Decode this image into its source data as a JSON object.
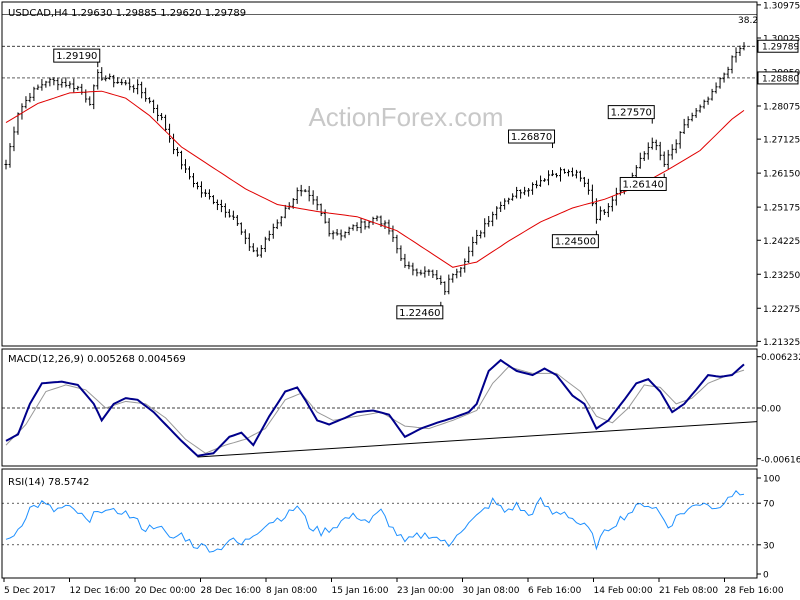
{
  "window": {
    "symbol_header": "USDCAD,H4 1.29630 1.29885 1.29620 1.29789",
    "watermark": "ActionForex.com"
  },
  "chart_data": [
    {
      "type": "line",
      "panel": "price",
      "title": "USDCAD,H4",
      "ohlc_header": {
        "open": 1.2963,
        "high": 1.29885,
        "low": 1.2962,
        "close": 1.29789
      },
      "ylim": [
        1.2125,
        1.31
      ],
      "y_ticks": [
        "1.30975",
        "1.30025",
        "1.29050",
        "1.28075",
        "1.27125",
        "1.26150",
        "1.25175",
        "1.24225",
        "1.23250",
        "1.22275",
        "1.21325"
      ],
      "x_ticks": [
        "5 Dec 2017",
        "12 Dec 16:00",
        "20 Dec 00:00",
        "28 Dec 16:00",
        "8 Jan 08:00",
        "15 Jan 16:00",
        "23 Jan 00:00",
        "30 Jan 08:00",
        "6 Feb 16:00",
        "14 Feb 00:00",
        "21 Feb 08:00",
        "28 Feb 16:00"
      ],
      "price_tags": [
        {
          "label": "1.29789",
          "value": 1.29789,
          "color": "#000000"
        },
        {
          "label": "1.28880",
          "value": 1.2888,
          "color": "#000000"
        }
      ],
      "fib_label": {
        "text": "38.2",
        "value": 1.307
      },
      "horizontal_levels": [
        1.307,
        1.29789,
        1.2888
      ],
      "annotations": [
        {
          "label": "1.29190",
          "bar": 23,
          "value": 1.2919
        },
        {
          "label": "1.22460",
          "bar": 109,
          "value": 1.2246
        },
        {
          "label": "1.26870",
          "bar": 137,
          "value": 1.2687
        },
        {
          "label": "1.24500",
          "bar": 148,
          "value": 1.245
        },
        {
          "label": "1.27570",
          "bar": 162,
          "value": 1.2757
        },
        {
          "label": "1.26140",
          "bar": 165,
          "value": 1.2614
        }
      ],
      "price_keypoints": [
        [
          0,
          1.264
        ],
        [
          3,
          1.279
        ],
        [
          6,
          1.284
        ],
        [
          10,
          1.288
        ],
        [
          14,
          1.2875
        ],
        [
          18,
          1.286
        ],
        [
          21,
          1.282
        ],
        [
          23,
          1.2895
        ],
        [
          27,
          1.288
        ],
        [
          30,
          1.287
        ],
        [
          33,
          1.286
        ],
        [
          36,
          1.282
        ],
        [
          39,
          1.277
        ],
        [
          42,
          1.269
        ],
        [
          45,
          1.262
        ],
        [
          49,
          1.256
        ],
        [
          53,
          1.253
        ],
        [
          57,
          1.249
        ],
        [
          60,
          1.242
        ],
        [
          63,
          1.238
        ],
        [
          67,
          1.246
        ],
        [
          70,
          1.251
        ],
        [
          73,
          1.256
        ],
        [
          75,
          1.2555
        ],
        [
          78,
          1.252
        ],
        [
          81,
          1.245
        ],
        [
          84,
          1.244
        ],
        [
          87,
          1.246
        ],
        [
          90,
          1.247
        ],
        [
          93,
          1.249
        ],
        [
          96,
          1.245
        ],
        [
          99,
          1.237
        ],
        [
          102,
          1.233
        ],
        [
          105,
          1.234
        ],
        [
          108,
          1.231
        ],
        [
          110,
          1.228
        ],
        [
          112,
          1.233
        ],
        [
          114,
          1.235
        ],
        [
          117,
          1.241
        ],
        [
          120,
          1.247
        ],
        [
          124,
          1.253
        ],
        [
          128,
          1.256
        ],
        [
          132,
          1.258
        ],
        [
          136,
          1.261
        ],
        [
          139,
          1.262
        ],
        [
          143,
          1.261
        ],
        [
          146,
          1.257
        ],
        [
          148,
          1.249
        ],
        [
          150,
          1.251
        ],
        [
          153,
          1.256
        ],
        [
          156,
          1.259
        ],
        [
          159,
          1.265
        ],
        [
          162,
          1.271
        ],
        [
          165,
          1.264
        ],
        [
          168,
          1.27
        ],
        [
          171,
          1.277
        ],
        [
          174,
          1.28
        ],
        [
          177,
          1.284
        ],
        [
          180,
          1.29
        ],
        [
          183,
          1.296
        ],
        [
          185,
          1.2979
        ]
      ],
      "ma_keypoints": [
        [
          0,
          1.276
        ],
        [
          8,
          1.2815
        ],
        [
          16,
          1.2845
        ],
        [
          24,
          1.285
        ],
        [
          30,
          1.283
        ],
        [
          36,
          1.278
        ],
        [
          44,
          1.269
        ],
        [
          52,
          1.263
        ],
        [
          60,
          1.257
        ],
        [
          68,
          1.2525
        ],
        [
          78,
          1.2505
        ],
        [
          88,
          1.249
        ],
        [
          98,
          1.245
        ],
        [
          106,
          1.239
        ],
        [
          112,
          1.2345
        ],
        [
          118,
          1.236
        ],
        [
          126,
          1.242
        ],
        [
          134,
          1.2475
        ],
        [
          142,
          1.2515
        ],
        [
          150,
          1.254
        ],
        [
          158,
          1.2575
        ],
        [
          166,
          1.2625
        ],
        [
          174,
          1.268
        ],
        [
          182,
          1.277
        ],
        [
          185,
          1.2795
        ]
      ]
    },
    {
      "type": "line",
      "panel": "macd",
      "title": "MACD(12,26,9) 0.005268 0.004569",
      "params": [
        12,
        26,
        9
      ],
      "values": {
        "macd": 0.005268,
        "signal": 0.004569
      },
      "ylim": [
        -0.0068,
        0.0068
      ],
      "y_ticks": [
        "0.006232",
        "0.00",
        "-0.006163"
      ],
      "zero_line": 0.0,
      "trendline": [
        [
          48,
          -0.00595
        ],
        [
          185,
          -0.00165
        ]
      ],
      "macd_keypoints": [
        [
          0,
          -0.004
        ],
        [
          3,
          -0.0032
        ],
        [
          6,
          0.0005
        ],
        [
          9,
          0.003
        ],
        [
          14,
          0.0032
        ],
        [
          18,
          0.0028
        ],
        [
          22,
          0.0005
        ],
        [
          24,
          -0.0015
        ],
        [
          27,
          0.0005
        ],
        [
          30,
          0.0012
        ],
        [
          33,
          0.001
        ],
        [
          37,
          -0.0005
        ],
        [
          40,
          -0.002
        ],
        [
          44,
          -0.004
        ],
        [
          48,
          -0.0058
        ],
        [
          52,
          -0.0055
        ],
        [
          56,
          -0.0035
        ],
        [
          59,
          -0.003
        ],
        [
          62,
          -0.0045
        ],
        [
          66,
          -0.001
        ],
        [
          70,
          0.002
        ],
        [
          73,
          0.0025
        ],
        [
          75,
          0.001
        ],
        [
          78,
          -0.0015
        ],
        [
          81,
          -0.002
        ],
        [
          85,
          -0.0012
        ],
        [
          88,
          -0.0005
        ],
        [
          92,
          -0.0003
        ],
        [
          96,
          -0.0008
        ],
        [
          100,
          -0.0035
        ],
        [
          104,
          -0.0025
        ],
        [
          108,
          -0.0018
        ],
        [
          112,
          -0.0012
        ],
        [
          116,
          -0.0005
        ],
        [
          118,
          0.0005
        ],
        [
          121,
          0.0045
        ],
        [
          124,
          0.0058
        ],
        [
          128,
          0.0045
        ],
        [
          132,
          0.004
        ],
        [
          135,
          0.0048
        ],
        [
          138,
          0.004
        ],
        [
          142,
          0.0015
        ],
        [
          145,
          0.0005
        ],
        [
          148,
          -0.0025
        ],
        [
          151,
          -0.0015
        ],
        [
          155,
          0.001
        ],
        [
          158,
          0.003
        ],
        [
          161,
          0.0035
        ],
        [
          164,
          0.002
        ],
        [
          167,
          -0.0005
        ],
        [
          170,
          0.0005
        ],
        [
          173,
          0.0022
        ],
        [
          176,
          0.004
        ],
        [
          179,
          0.0038
        ],
        [
          182,
          0.004
        ],
        [
          185,
          0.0053
        ]
      ],
      "signal_keypoints": [
        [
          0,
          -0.0045
        ],
        [
          5,
          -0.002
        ],
        [
          10,
          0.002
        ],
        [
          15,
          0.0028
        ],
        [
          20,
          0.0022
        ],
        [
          25,
          0.0
        ],
        [
          30,
          0.0008
        ],
        [
          35,
          0.0005
        ],
        [
          40,
          -0.0012
        ],
        [
          45,
          -0.0038
        ],
        [
          50,
          -0.0055
        ],
        [
          55,
          -0.0045
        ],
        [
          60,
          -0.0038
        ],
        [
          65,
          -0.0025
        ],
        [
          70,
          0.001
        ],
        [
          74,
          0.0018
        ],
        [
          78,
          -0.0005
        ],
        [
          82,
          -0.0015
        ],
        [
          88,
          -0.001
        ],
        [
          94,
          -0.0005
        ],
        [
          100,
          -0.0022
        ],
        [
          106,
          -0.0025
        ],
        [
          112,
          -0.0015
        ],
        [
          118,
          -0.0003
        ],
        [
          122,
          0.003
        ],
        [
          126,
          0.005
        ],
        [
          132,
          0.0042
        ],
        [
          138,
          0.0042
        ],
        [
          144,
          0.002
        ],
        [
          148,
          -0.001
        ],
        [
          152,
          -0.0018
        ],
        [
          156,
          0.0
        ],
        [
          160,
          0.0028
        ],
        [
          164,
          0.0025
        ],
        [
          168,
          0.0005
        ],
        [
          172,
          0.0012
        ],
        [
          176,
          0.003
        ],
        [
          180,
          0.0038
        ],
        [
          185,
          0.0046
        ]
      ]
    },
    {
      "type": "line",
      "panel": "rsi",
      "title": "RSI(14) 78.5742",
      "params": [
        14
      ],
      "values": {
        "rsi": 78.5742
      },
      "ylim": [
        0,
        100
      ],
      "y_ticks": [
        "100",
        "70",
        "30",
        "0"
      ],
      "levels": [
        70,
        30
      ],
      "rsi_keypoints": [
        [
          0,
          32
        ],
        [
          3,
          45
        ],
        [
          6,
          65
        ],
        [
          9,
          70
        ],
        [
          12,
          63
        ],
        [
          15,
          66
        ],
        [
          18,
          61
        ],
        [
          21,
          50
        ],
        [
          23,
          66
        ],
        [
          26,
          60
        ],
        [
          29,
          63
        ],
        [
          32,
          55
        ],
        [
          35,
          45
        ],
        [
          38,
          50
        ],
        [
          41,
          35
        ],
        [
          44,
          40
        ],
        [
          47,
          30
        ],
        [
          50,
          28
        ],
        [
          53,
          25
        ],
        [
          56,
          35
        ],
        [
          59,
          30
        ],
        [
          62,
          40
        ],
        [
          65,
          50
        ],
        [
          68,
          55
        ],
        [
          71,
          60
        ],
        [
          73,
          68
        ],
        [
          76,
          48
        ],
        [
          79,
          42
        ],
        [
          82,
          47
        ],
        [
          85,
          55
        ],
        [
          88,
          58
        ],
        [
          91,
          52
        ],
        [
          94,
          62
        ],
        [
          97,
          45
        ],
        [
          100,
          32
        ],
        [
          103,
          38
        ],
        [
          106,
          40
        ],
        [
          109,
          35
        ],
        [
          111,
          28
        ],
        [
          113,
          42
        ],
        [
          116,
          50
        ],
        [
          119,
          60
        ],
        [
          122,
          72
        ],
        [
          125,
          62
        ],
        [
          128,
          68
        ],
        [
          131,
          58
        ],
        [
          134,
          72
        ],
        [
          137,
          60
        ],
        [
          140,
          62
        ],
        [
          143,
          52
        ],
        [
          146,
          45
        ],
        [
          148,
          30
        ],
        [
          151,
          46
        ],
        [
          154,
          55
        ],
        [
          157,
          63
        ],
        [
          160,
          70
        ],
        [
          163,
          65
        ],
        [
          166,
          48
        ],
        [
          169,
          60
        ],
        [
          172,
          66
        ],
        [
          175,
          72
        ],
        [
          178,
          64
        ],
        [
          181,
          78
        ],
        [
          185,
          78.57
        ]
      ]
    }
  ]
}
